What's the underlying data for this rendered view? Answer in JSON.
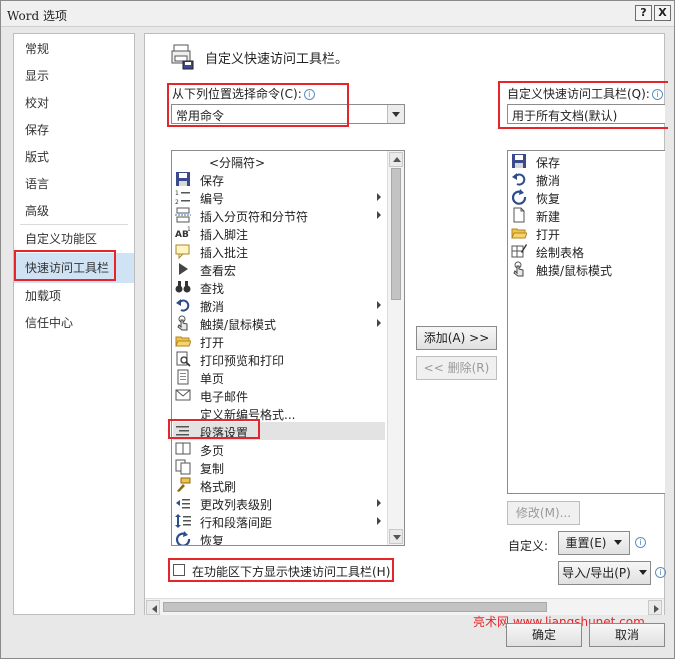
{
  "window": {
    "title": "Word 选项",
    "help_label": "?",
    "close_label": "X"
  },
  "nav": {
    "items": [
      {
        "label": "常规"
      },
      {
        "label": "显示"
      },
      {
        "label": "校对"
      },
      {
        "label": "保存"
      },
      {
        "label": "版式"
      },
      {
        "label": "语言"
      },
      {
        "label": "高级"
      },
      {
        "label": "自定义功能区"
      },
      {
        "label": "快速访问工具栏",
        "selected": true
      },
      {
        "label": "加载项"
      },
      {
        "label": "信任中心"
      }
    ]
  },
  "panel": {
    "heading": "自定义快速访问工具栏。",
    "choose_from": {
      "label": "从下列位置选择命令(C):",
      "info": "i",
      "value": "常用命令"
    },
    "customize_for": {
      "label": "自定义快速访问工具栏(Q):",
      "info": "i",
      "value": "用于所有文档(默认)"
    }
  },
  "commands": [
    {
      "label": "<分隔符>",
      "icon": "none"
    },
    {
      "label": "保存",
      "icon": "save-icon"
    },
    {
      "label": "编号",
      "icon": "numbering-icon",
      "submenu": true
    },
    {
      "label": "插入分页符和分节符",
      "icon": "page-break-icon",
      "submenu": true
    },
    {
      "label": "插入脚注",
      "icon": "footnote-icon"
    },
    {
      "label": "插入批注",
      "icon": "comment-icon"
    },
    {
      "label": "查看宏",
      "icon": "macro-icon"
    },
    {
      "label": "查找",
      "icon": "find-icon"
    },
    {
      "label": "撤消",
      "icon": "undo-icon",
      "submenu": true
    },
    {
      "label": "触摸/鼠标模式",
      "icon": "touch-mode-icon",
      "submenu": true
    },
    {
      "label": "打开",
      "icon": "open-folder-icon"
    },
    {
      "label": "打印预览和打印",
      "icon": "print-preview-icon"
    },
    {
      "label": "单页",
      "icon": "one-page-icon"
    },
    {
      "label": "电子邮件",
      "icon": "email-icon"
    },
    {
      "label": "定义新编号格式...",
      "icon": "none"
    },
    {
      "label": "段落设置",
      "icon": "paragraph-icon",
      "selected": true
    },
    {
      "label": "多页",
      "icon": "multi-page-icon"
    },
    {
      "label": "复制",
      "icon": "copy-icon"
    },
    {
      "label": "格式刷",
      "icon": "format-painter-icon"
    },
    {
      "label": "更改列表级别",
      "icon": "list-level-icon",
      "submenu": true
    },
    {
      "label": "行和段落间距",
      "icon": "line-spacing-icon",
      "submenu": true
    },
    {
      "label": "恢复",
      "icon": "redo-icon"
    }
  ],
  "toolbar_items": [
    {
      "label": "保存",
      "icon": "save-icon"
    },
    {
      "label": "撤消",
      "icon": "undo-icon"
    },
    {
      "label": "恢复",
      "icon": "redo-icon"
    },
    {
      "label": "新建",
      "icon": "new-doc-icon"
    },
    {
      "label": "打开",
      "icon": "open-folder-icon"
    },
    {
      "label": "绘制表格",
      "icon": "draw-table-icon"
    },
    {
      "label": "触摸/鼠标模式",
      "icon": "touch-mode-icon"
    }
  ],
  "buttons": {
    "add": "添加(A) >>",
    "remove": "<< 删除(R)",
    "modify": "修改(M)...",
    "customize_label": "自定义:",
    "reset": "重置(E)",
    "import_export": "导入/导出(P)",
    "ok": "确定",
    "cancel": "取消"
  },
  "checkbox": {
    "label": "在功能区下方显示快速访问工具栏(H)",
    "checked": false
  },
  "watermark": "亮术网 www.liangshunet.com",
  "colors": {
    "highlight_box": "#e4262b",
    "nav_selected": "#cfe3f5"
  }
}
